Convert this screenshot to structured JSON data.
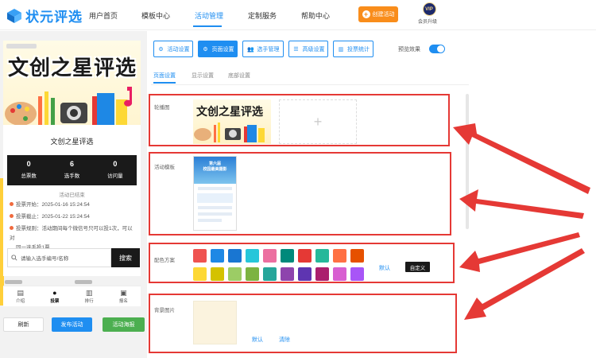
{
  "app": {
    "logo_text": "状元评选"
  },
  "nav": {
    "items": [
      {
        "label": "用户首页"
      },
      {
        "label": "模板中心"
      },
      {
        "label": "活动管理"
      },
      {
        "label": "定制服务"
      },
      {
        "label": "帮助中心"
      }
    ],
    "create_button": "创建活动",
    "vip_badge": "VIP",
    "vip_label": "会员升级"
  },
  "preview": {
    "banner_title": "文创之星评选",
    "activity_title": "文创之星评选",
    "stats": [
      {
        "value": "0",
        "label": "总票数"
      },
      {
        "value": "6",
        "label": "选手数"
      },
      {
        "value": "0",
        "label": "访问量"
      }
    ],
    "status": "活动已结束",
    "vote_start": "投票开始：2025-01-16 15:24:54",
    "vote_end": "投票截止：2025-01-22 15:24:54",
    "vote_rule_line1": "投票规则：活动期间每个微信号只可以投1次，可以对",
    "vote_rule_line2": "同一选手投1票",
    "search_placeholder": "请输入选手编号/名称",
    "search_button": "搜索",
    "tabs": [
      {
        "label": "介绍"
      },
      {
        "label": "投票"
      },
      {
        "label": "排行"
      },
      {
        "label": "报名"
      }
    ],
    "buttons": {
      "refresh": "刷新",
      "publish": "发布活动",
      "poster": "活动海报"
    }
  },
  "toolbar": {
    "buttons": [
      {
        "label": "活动设置"
      },
      {
        "label": "页面设置"
      },
      {
        "label": "选手管理"
      },
      {
        "label": "高级设置"
      },
      {
        "label": "投票统计"
      }
    ],
    "preview_label": "预览效果"
  },
  "subtabs": [
    {
      "label": "页面设置"
    },
    {
      "label": "显示设置"
    },
    {
      "label": "底部设置"
    }
  ],
  "sections": {
    "carousel": {
      "label": "轮播图",
      "image_title": "文创之星评选",
      "add": "+"
    },
    "template": {
      "label": "活动模板",
      "thumb_title_1": "第六届",
      "thumb_title_2": "校园最美摄影"
    },
    "color_scheme": {
      "label": "配色方案",
      "default_link": "默认",
      "custom_button": "自定义",
      "colors_row1": [
        "#ef5350",
        "#1e88e5",
        "#1976d2",
        "#26c6da",
        "#ec6fa0",
        "#00897b",
        "#e53935",
        "#26b89a",
        "#ff7043",
        "#e65100"
      ],
      "colors_row2": [
        "#fdd835",
        "#d4c200",
        "#9ccc65",
        "#7cb342",
        "#26a69a",
        "#8e44ad",
        "#5e35b1",
        "#ab1f6d",
        "#d85fd1",
        "#a855f7"
      ]
    },
    "background": {
      "label": "背景图片",
      "default_link": "默认",
      "clear_link": "清除"
    }
  },
  "colors": {
    "accent": "#1f8ef1",
    "highlight": "#e53935",
    "orange": "#f98d1b",
    "green": "#4caf50"
  }
}
